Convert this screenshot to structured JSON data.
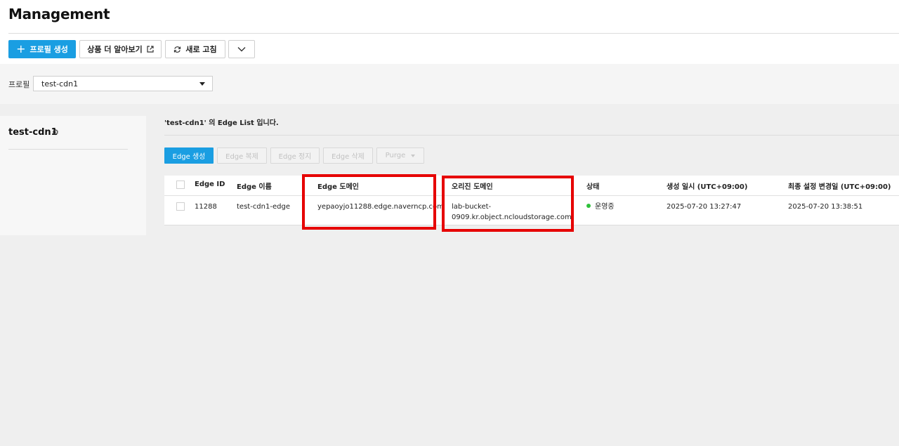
{
  "header": {
    "title": "Management",
    "create_profile_label": "프로필 생성",
    "learn_more_label": "상품 더 알아보기",
    "refresh_label": "새로 고침"
  },
  "filter": {
    "label": "프로필",
    "selected": "test-cdn1"
  },
  "profile": {
    "name": "test-cdn1"
  },
  "edge_list": {
    "title": "'test-cdn1' 의 Edge List 입니다.",
    "actions": {
      "create": "Edge 생성",
      "copy": "Edge 복제",
      "stop": "Edge 정지",
      "delete": "Edge 삭제",
      "purge": "Purge"
    },
    "columns": {
      "id": "Edge ID",
      "name": "Edge 이름",
      "domain": "Edge 도메인",
      "origin": "오리진 도메인",
      "status": "상태",
      "created": "생성 일시 (UTC+09:00)",
      "modified": "최종 설정 변경일 (UTC+09:00)"
    },
    "rows": [
      {
        "id": "11288",
        "name": "test-cdn1-edge",
        "domain": "yepaoyjo11288.edge.naverncp.com",
        "origin_line1": "lab-bucket-",
        "origin_line2": "0909.kr.object.ncloudstorage.com",
        "status": "운영중",
        "created": "2025-07-20 13:27:47",
        "modified": "2025-07-20 13:38:51"
      }
    ]
  },
  "colors": {
    "primary": "#1a9ee2",
    "highlight": "#e60000",
    "status_running": "#2ec13a"
  }
}
